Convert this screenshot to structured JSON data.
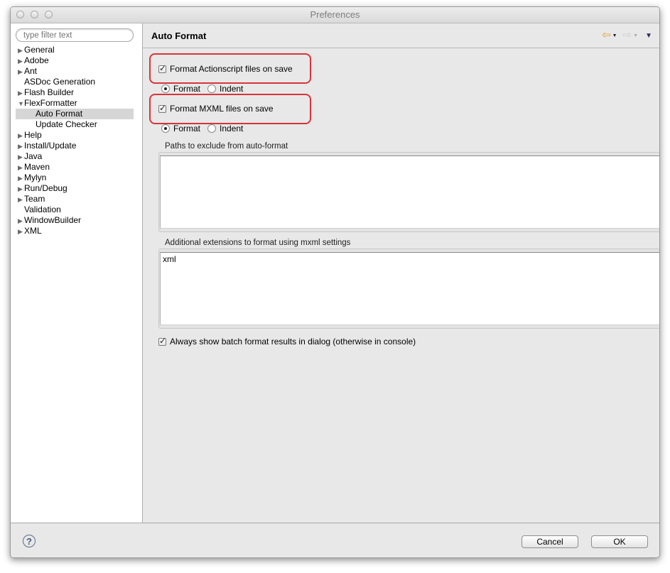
{
  "window": {
    "title": "Preferences",
    "controls": [
      "close",
      "minimize",
      "zoom"
    ]
  },
  "sidebar": {
    "filter_placeholder": "type filter text",
    "items": [
      {
        "label": "General",
        "expandable": true,
        "expanded": false,
        "level": 0
      },
      {
        "label": "Adobe",
        "expandable": true,
        "expanded": false,
        "level": 0
      },
      {
        "label": "Ant",
        "expandable": true,
        "expanded": false,
        "level": 0
      },
      {
        "label": "ASDoc Generation",
        "expandable": false,
        "level": 0
      },
      {
        "label": "Flash Builder",
        "expandable": true,
        "expanded": false,
        "level": 0
      },
      {
        "label": "FlexFormatter",
        "expandable": true,
        "expanded": true,
        "level": 0
      },
      {
        "label": "Auto Format",
        "expandable": false,
        "level": 1,
        "selected": true
      },
      {
        "label": "Update Checker",
        "expandable": false,
        "level": 1
      },
      {
        "label": "Help",
        "expandable": true,
        "expanded": false,
        "level": 0
      },
      {
        "label": "Install/Update",
        "expandable": true,
        "expanded": false,
        "level": 0
      },
      {
        "label": "Java",
        "expandable": true,
        "expanded": false,
        "level": 0
      },
      {
        "label": "Maven",
        "expandable": true,
        "expanded": false,
        "level": 0
      },
      {
        "label": "Mylyn",
        "expandable": true,
        "expanded": false,
        "level": 0
      },
      {
        "label": "Run/Debug",
        "expandable": true,
        "expanded": false,
        "level": 0
      },
      {
        "label": "Team",
        "expandable": true,
        "expanded": false,
        "level": 0
      },
      {
        "label": "Validation",
        "expandable": false,
        "level": 0
      },
      {
        "label": "WindowBuilder",
        "expandable": true,
        "expanded": false,
        "level": 0
      },
      {
        "label": "XML",
        "expandable": true,
        "expanded": false,
        "level": 0
      }
    ]
  },
  "main": {
    "title": "Auto Format",
    "nav": {
      "back": "back-arrow",
      "forward": "forward-arrow",
      "menu": "view-menu"
    },
    "actionscript": {
      "label": "Format Actionscript files on save",
      "checked": true,
      "mode_options": [
        "Format",
        "Indent"
      ],
      "selected_mode": "Format"
    },
    "mxml": {
      "label": "Format MXML files on save",
      "checked": true,
      "mode_options": [
        "Format",
        "Indent"
      ],
      "selected_mode": "Format"
    },
    "exclude_paths": {
      "label": "Paths to exclude from auto-format",
      "value": ""
    },
    "extensions": {
      "label": "Additional extensions to format using mxml settings",
      "value": "xml"
    },
    "batch_dialog": {
      "label": "Always show batch format results in dialog (otherwise in console)",
      "checked": true
    },
    "highlight_color": "#d9343a"
  },
  "footer": {
    "help_icon": "help-icon",
    "cancel_label": "Cancel",
    "ok_label": "OK"
  }
}
